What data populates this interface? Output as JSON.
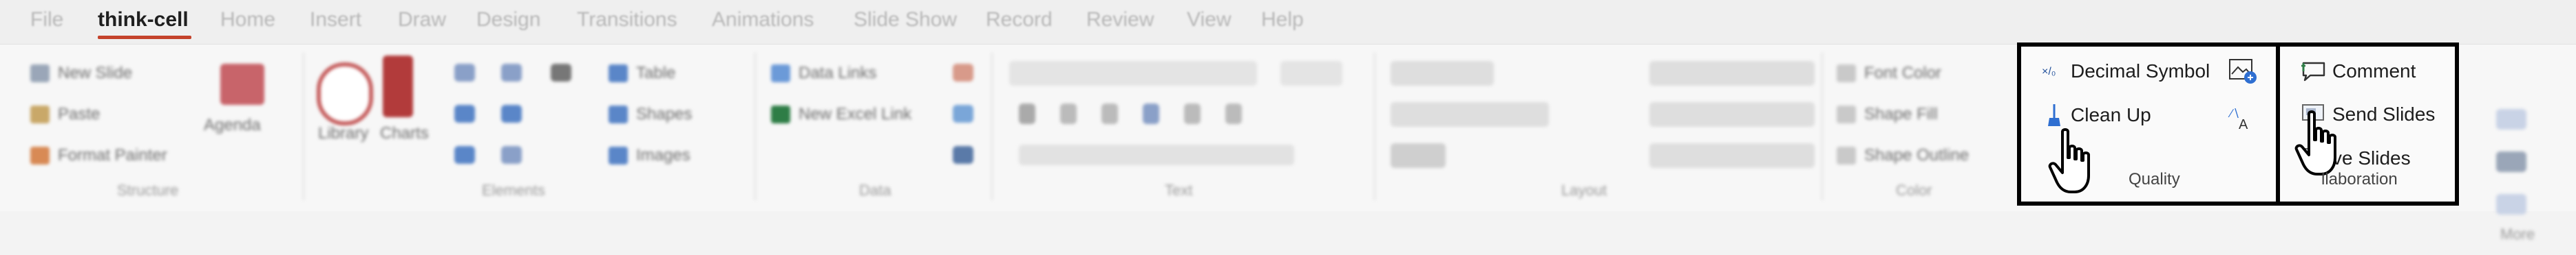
{
  "tabs": [
    "File",
    "think-cell",
    "Home",
    "Insert",
    "Draw",
    "Design",
    "Transitions",
    "Animations",
    "Slide Show",
    "Record",
    "Review",
    "View",
    "Help"
  ],
  "active_tab": "think-cell",
  "groups": {
    "structure": {
      "label": "Structure",
      "new_slide": "New Slide",
      "paste": "Paste",
      "format_painter": "Format Painter",
      "agenda": "Agenda"
    },
    "elements": {
      "label": "Elements",
      "library": "Library",
      "charts": "Charts",
      "table": "Table",
      "shapes": "Shapes",
      "images": "Images"
    },
    "data": {
      "label": "Data",
      "data_links": "Data Links",
      "new_excel_link": "New Excel Link"
    },
    "text": {
      "label": "Text"
    },
    "layout": {
      "label": "Layout"
    },
    "color": {
      "label": "Color",
      "font_color": "Font Color",
      "shape_fill": "Shape Fill",
      "shape_outline": "Shape Outline"
    },
    "quality": {
      "label": "Quality",
      "decimal_symbol": "Decimal Symbol",
      "clean_up": "Clean Up"
    },
    "collaboration": {
      "label": "Collaboration",
      "comment": "Comment",
      "send_slides": "Send Slides",
      "save_slides": "Save Slides",
      "save_slides_visible": "ve Slides",
      "label_visible": "llaboration"
    },
    "more": {
      "label": "More"
    }
  },
  "colors": {
    "accent_underline": "#c4422b",
    "highlight_border": "#000000",
    "ribbon_bg": "#f7f7f7"
  }
}
